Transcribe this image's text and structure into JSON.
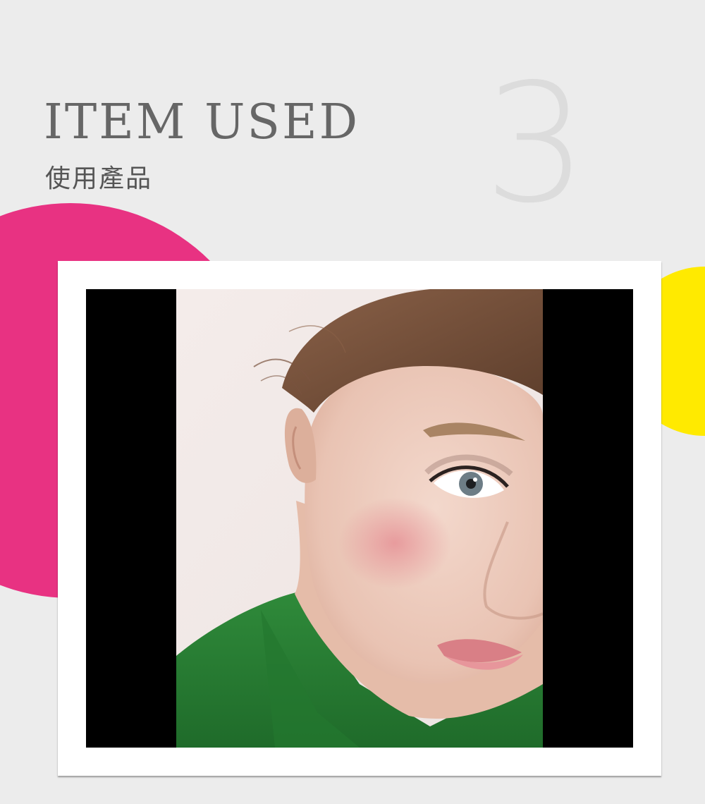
{
  "section": {
    "number": "3",
    "title": "ITEM USED",
    "subtitle": "使用產品"
  },
  "colors": {
    "background": "#ececec",
    "accent_pink": "#e83282",
    "accent_yellow": "#ffea00",
    "frame": "#ffffff",
    "photo_letterbox": "#000000"
  },
  "photo": {
    "description_icon": "model-portrait-image"
  }
}
